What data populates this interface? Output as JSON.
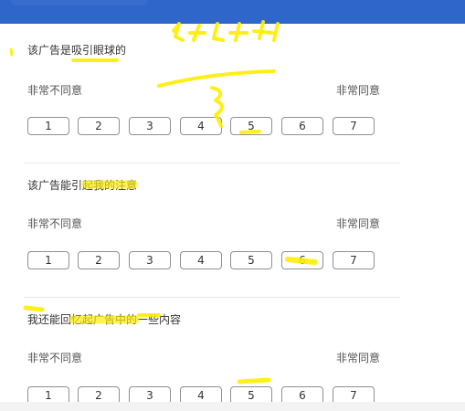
{
  "questions": [
    {
      "text": "该广告是吸引眼球的",
      "left_label": "非常不同意",
      "right_label": "非常同意",
      "options": [
        "1",
        "2",
        "3",
        "4",
        "5",
        "6",
        "7"
      ]
    },
    {
      "text": "该广告能引起我的注意",
      "left_label": "非常不同意",
      "right_label": "非常同意",
      "options": [
        "1",
        "2",
        "3",
        "4",
        "5",
        "6",
        "7"
      ]
    },
    {
      "text": "我还能回忆起广告中的一些内容",
      "left_label": "非常不同意",
      "right_label": "非常同意",
      "options": [
        "1",
        "2",
        "3",
        "4",
        "5",
        "6",
        "7"
      ]
    }
  ],
  "colors": {
    "topbar": "#2f66c9",
    "highlight": "#ffee00"
  }
}
